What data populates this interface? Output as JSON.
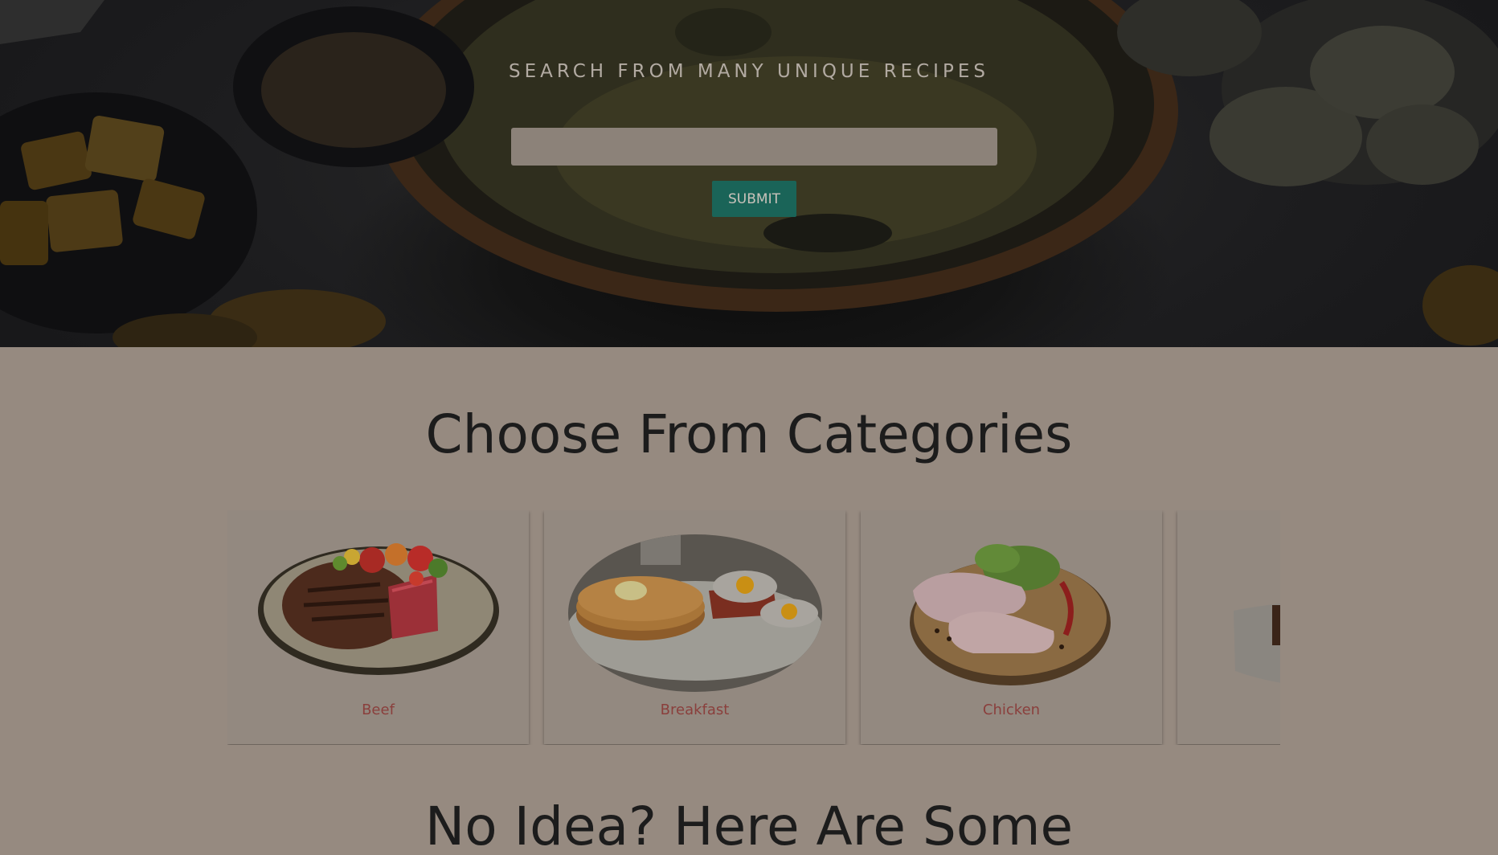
{
  "hero": {
    "tagline": "SEARCH FROM MANY UNIQUE RECIPES",
    "search": {
      "value": "",
      "placeholder": ""
    },
    "submit_label": "SUBMIT"
  },
  "categories": {
    "title": "Choose From Categories",
    "items": [
      {
        "label": "Beef",
        "image": "steak-plate"
      },
      {
        "label": "Breakfast",
        "image": "pancakes-eggs-bacon"
      },
      {
        "label": "Chicken",
        "image": "raw-chicken-legs"
      },
      {
        "label": "",
        "image": "dessert-plate-partial"
      }
    ]
  },
  "ideas": {
    "title": "No Idea? Here Are Some"
  },
  "colors": {
    "overlay_background": "#968a80",
    "submit_button": "#1a6458",
    "category_label": "#8a3f3c",
    "heading_text": "#1c1c1c"
  }
}
